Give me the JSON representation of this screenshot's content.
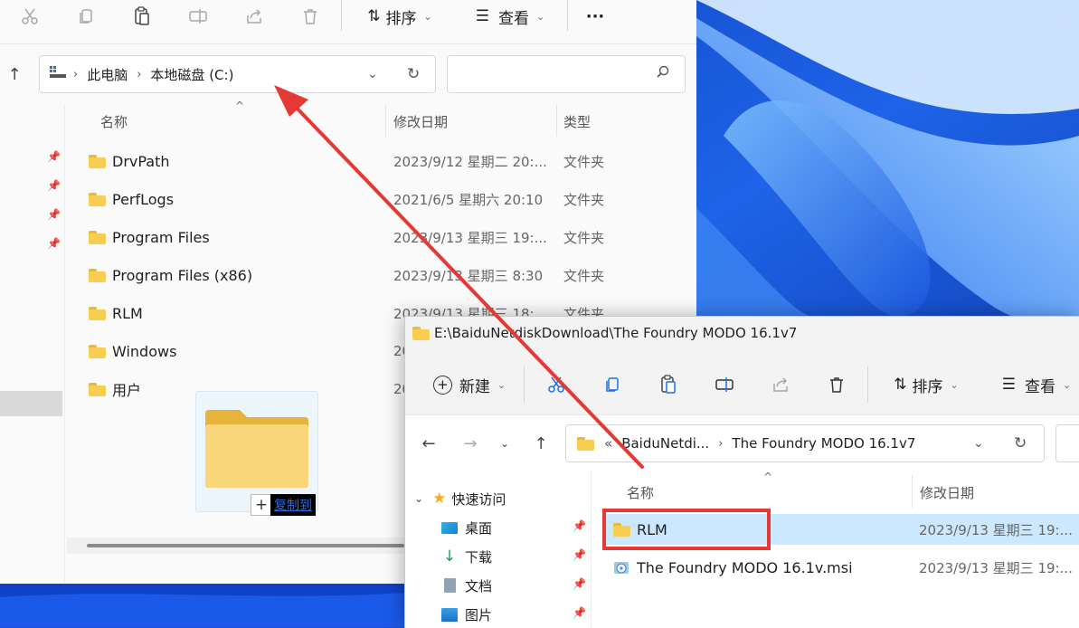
{
  "win1": {
    "toolbar": {
      "sort_label": "排序",
      "view_label": "查看",
      "more_label": "···"
    },
    "address": {
      "segments": [
        "此电脑",
        "本地磁盘 (C:)"
      ]
    },
    "columns": {
      "name": "名称",
      "date": "修改日期",
      "type": "类型"
    },
    "rows": [
      {
        "name": "DrvPath",
        "date": "2023/9/12 星期二 20:...",
        "type": "文件夹"
      },
      {
        "name": "PerfLogs",
        "date": "2021/6/5 星期六 20:10",
        "type": "文件夹"
      },
      {
        "name": "Program Files",
        "date": "2023/9/13 星期三 19:...",
        "type": "文件夹"
      },
      {
        "name": "Program Files (x86)",
        "date": "2023/9/13 星期三 8:30",
        "type": "文件夹"
      },
      {
        "name": "RLM",
        "date": "2023/9/13 星期三 18:...",
        "type": "文件夹"
      },
      {
        "name": "Windows",
        "date": "20",
        "type": ""
      },
      {
        "name": "用户",
        "date": "20",
        "type": ""
      }
    ]
  },
  "drag": {
    "label": "复制到"
  },
  "win2": {
    "title": "E:\\BaiduNetdiskDownload\\The Foundry MODO 16.1v7",
    "toolbar": {
      "new_label": "新建",
      "sort_label": "排序",
      "view_label": "查看"
    },
    "address": {
      "prefix": "«",
      "segments": [
        "BaiduNetdi...",
        "The Foundry MODO 16.1v7"
      ]
    },
    "columns": {
      "name": "名称",
      "date": "修改日期"
    },
    "nav": {
      "quick_access": "快速访问",
      "items": [
        "桌面",
        "下载",
        "文档",
        "图片"
      ]
    },
    "rows": [
      {
        "name": "RLM",
        "date": "2023/9/13 星期三 19:..."
      },
      {
        "name": "The Foundry MODO 16.1v.msi",
        "date": "2023/9/13 星期三 19:..."
      }
    ]
  },
  "colors": {
    "accent": "#0067c0",
    "highlight": "#cce8ff",
    "annotation": "#e53935"
  }
}
